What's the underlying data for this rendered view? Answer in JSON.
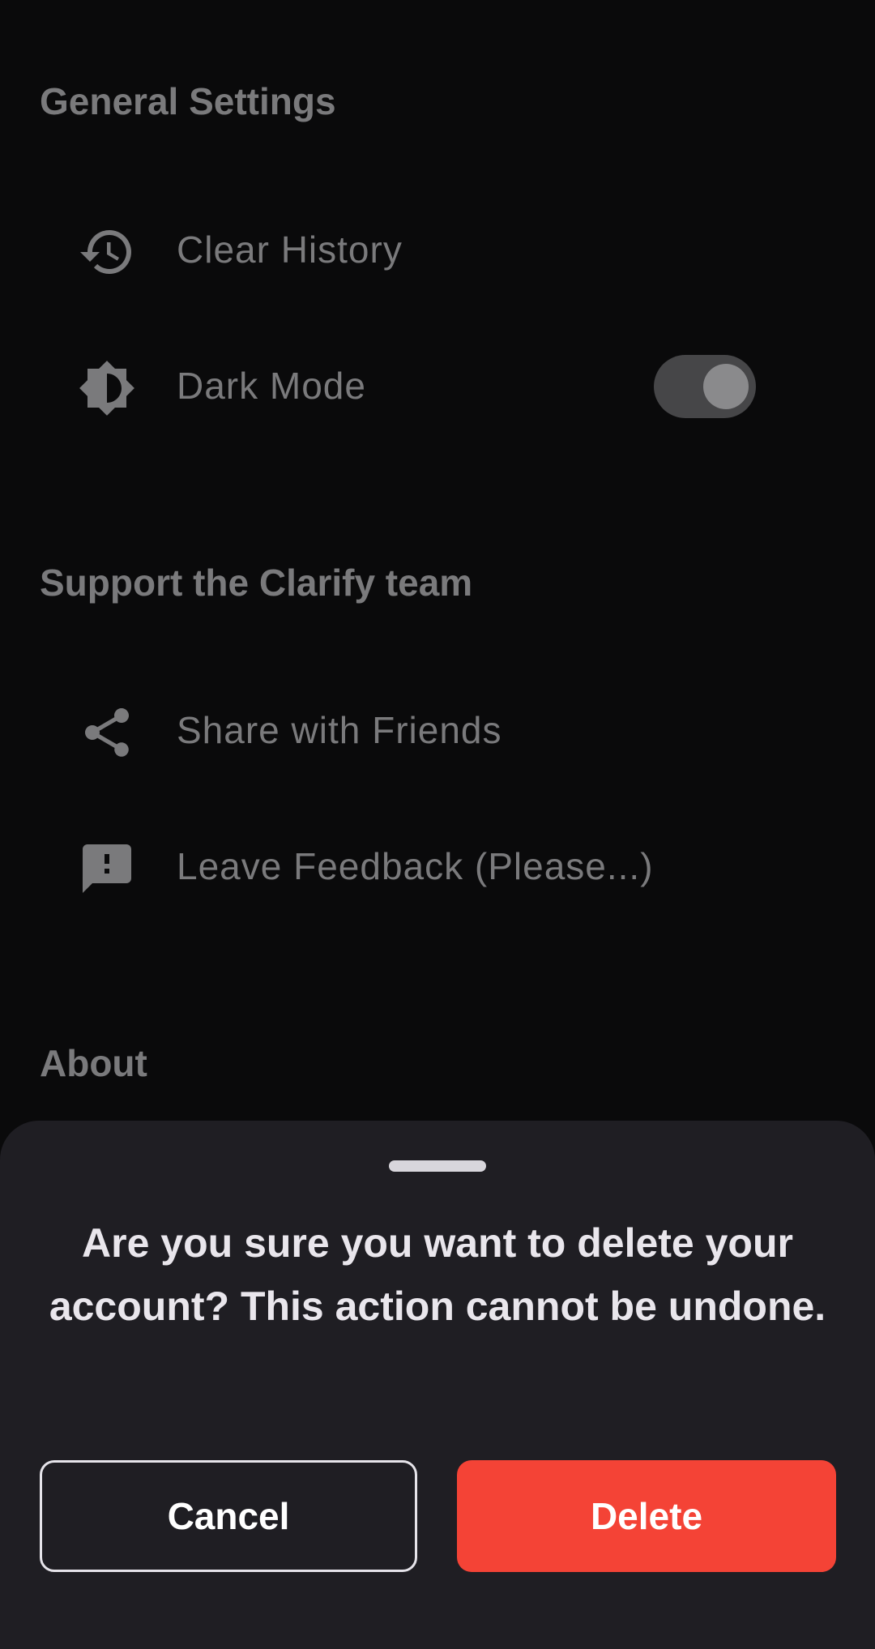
{
  "sections": {
    "general": {
      "title": "General Settings",
      "items": [
        {
          "label": "Clear History",
          "icon": "history-icon"
        },
        {
          "label": "Dark Mode",
          "icon": "brightness-icon",
          "toggle_on": true
        }
      ]
    },
    "support": {
      "title": "Support the Clarify team",
      "items": [
        {
          "label": "Share with Friends",
          "icon": "share-icon"
        },
        {
          "label": "Leave Feedback (Please...)",
          "icon": "feedback-icon"
        }
      ]
    },
    "about": {
      "title": "About"
    }
  },
  "dialog": {
    "message": "Are you sure you want to delete your account? This action cannot be undone.",
    "cancel_label": "Cancel",
    "delete_label": "Delete"
  },
  "colors": {
    "background": "#0a0a0b",
    "sheet": "#1f1e23",
    "muted_text": "#7a7a7c",
    "danger": "#f44336"
  }
}
